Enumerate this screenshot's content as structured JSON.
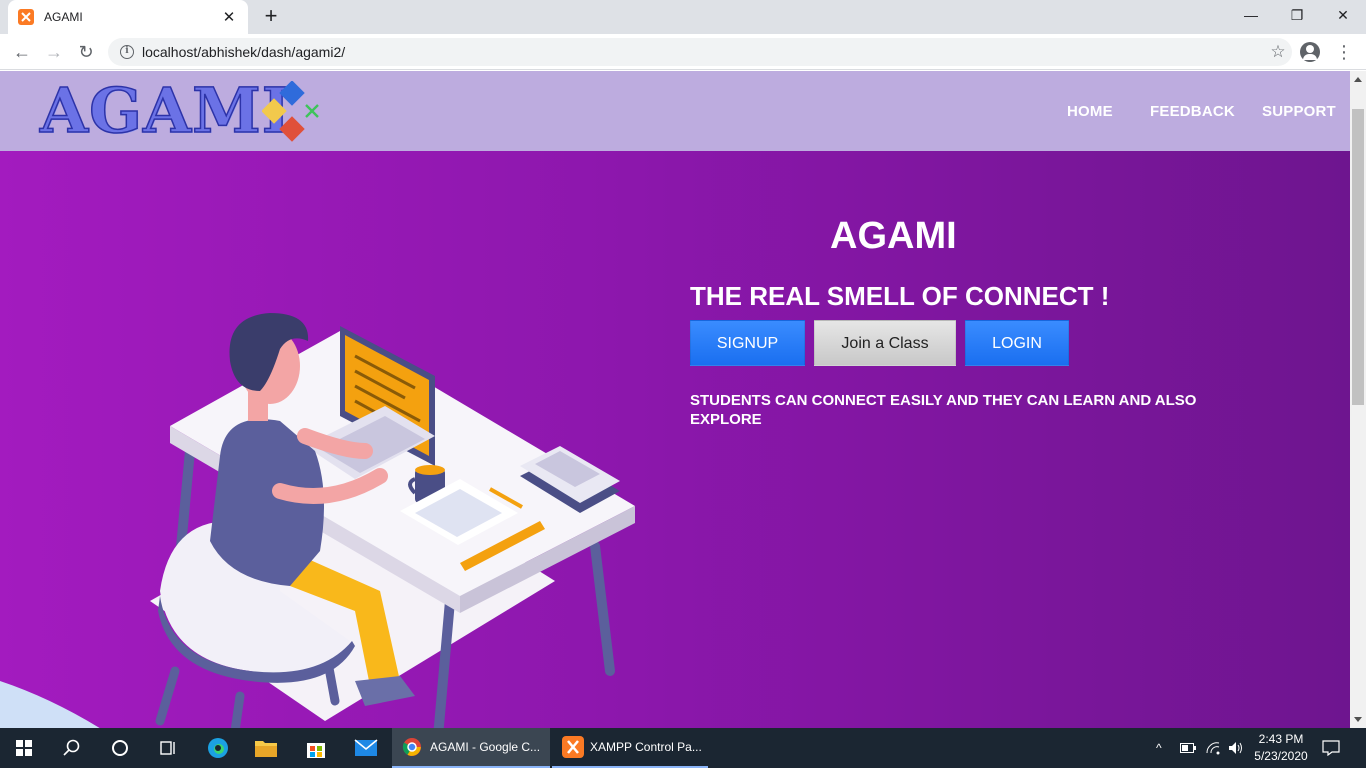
{
  "browser": {
    "tab_title": "AGAMI",
    "new_tab_label": "+",
    "url": "localhost/abhishek/dash/agami2/"
  },
  "site": {
    "logo_text": "AGAMI",
    "nav": {
      "home": "HOME",
      "feedback": "FEEDBACK",
      "support": "SUPPORT"
    }
  },
  "hero": {
    "title": "AGAMI",
    "tagline": "THE REAL SMELL OF CONNECT !",
    "buttons": {
      "signup": "SIGNUP",
      "join": "Join a Class",
      "login": "LOGIN"
    },
    "description": "STUDENTS CAN CONNECT EASILY AND THEY CAN LEARN AND ALSO EXPLORE"
  },
  "taskbar": {
    "apps": [
      {
        "label": "AGAMI - Google C..."
      },
      {
        "label": "XAMPP Control Pa..."
      }
    ],
    "time": "2:43 PM",
    "date": "5/23/2020"
  },
  "colors": {
    "nav_bg": "#bdacdf",
    "hero_start": "#a31bbf",
    "hero_end": "#6e158f",
    "button_blue": "#1a6ff0",
    "button_grey": "#c8c8c8"
  }
}
